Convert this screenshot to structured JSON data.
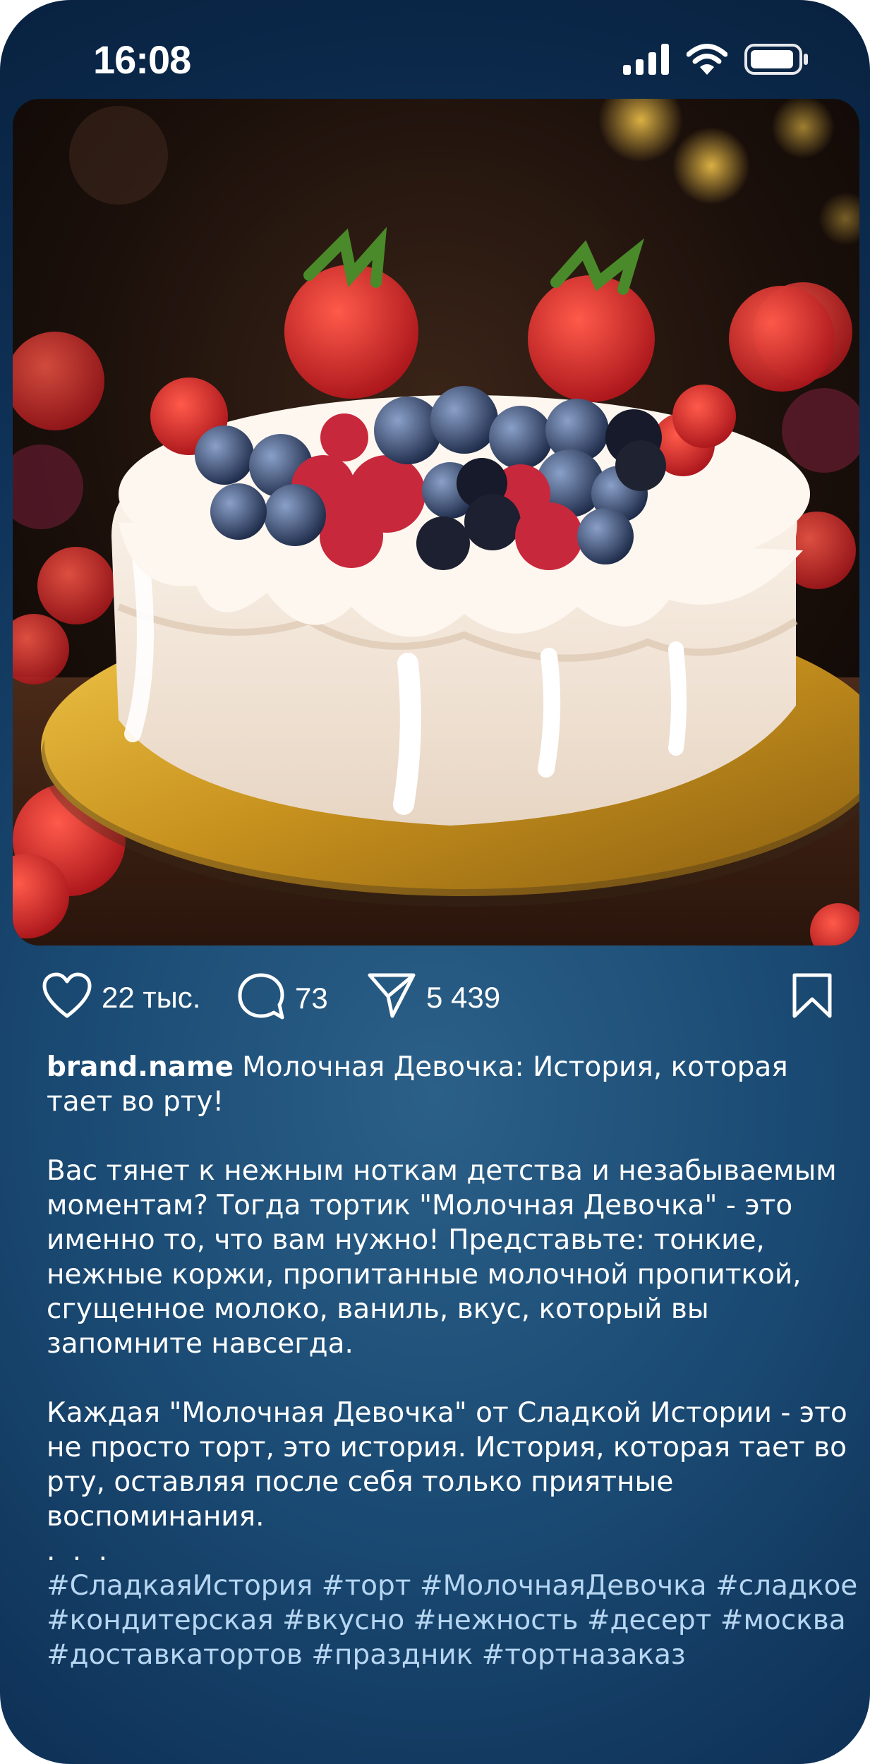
{
  "status_bar": {
    "time": "16:08",
    "icons": [
      "signal-icon",
      "wifi-icon",
      "battery-icon"
    ]
  },
  "post": {
    "image": "cake-photo",
    "likes": "22 тыс.",
    "comments": "73",
    "shares": "5 439",
    "icons": [
      "heart-icon",
      "comment-icon",
      "send-icon",
      "bookmark-icon"
    ]
  },
  "caption": {
    "username": "brand.name",
    "title": "Молочная Девочка: История, которая тает во рту!",
    "paragraph1": "Вас тянет к нежным ноткам детства и незабываемым моментам?  Тогда тортик \"Молочная Девочка\" - это именно то, что вам нужно!  Представьте: тонкие, нежные коржи, пропитанные молочной пропиткой, сгущенное молоко, ваниль,  вкус, который вы запомните навсегда.",
    "paragraph2": "Каждая \"Молочная Девочка\" от Сладкой Истории - это не просто торт, это история.  История, которая тает во рту, оставляя после себя только приятные воспоминания.",
    "ellipsis": ". . .",
    "hashtags": "#СладкаяИстория #торт #МолочнаяДевочка #сладкое #кондитерская #вкусно #нежность #десерт #москва #доставкатортов #праздник #тортназаказ"
  },
  "colors": {
    "background_center": "#2b6088",
    "background_edge": "#08203e",
    "hashtag": "#b6d6f2",
    "text": "#ffffff"
  }
}
